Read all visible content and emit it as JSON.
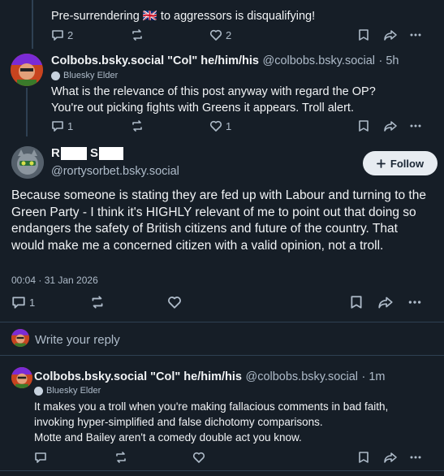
{
  "post_top": {
    "text": "Pre-surrendering 🇬🇧 to aggressors is disqualifying!",
    "reply_count": "2",
    "like_count": "2"
  },
  "post_col1": {
    "display_name": "Colbobs.bsky.social \"Col\" he/him/his",
    "handle": "@colbobs.bsky.social",
    "time": "· 5h",
    "badge": "Bluesky Elder",
    "text_line1": "What is the relevance of this post anyway with regard the OP?",
    "text_line2": "You're out picking fights with Greens it appears. Troll alert.",
    "reply_count": "1",
    "like_count": "1"
  },
  "main_post": {
    "name_initial1": "R",
    "name_initial2": "S",
    "handle": "@rortysorbet.bsky.social",
    "follow_label": "Follow",
    "text": "Because someone is stating they are fed up with Labour and turning to the Green Party - I think it's HIGHLY relevant of me to point out that doing so endangers the safety of British citizens and future of the country.  That would make me a concerned citizen with a valid opinion, not a troll.",
    "timestamp": "00:04 · 31 Jan 2026",
    "reply_count": "1"
  },
  "composer": {
    "placeholder": "Write your reply"
  },
  "post_col2": {
    "display_name": "Colbobs.bsky.social \"Col\" he/him/his",
    "handle": "@colbobs.bsky.social",
    "time": "· 1m",
    "badge": "Bluesky Elder",
    "text_line1": "It makes you a troll when you're making fallacious comments in bad faith,",
    "text_line2": "invoking hyper-simplified and false dichotomy comparisons.",
    "text_line3": "Motte and Bailey aren't a comedy double act you know."
  },
  "icons": [
    "reply-icon",
    "repost-icon",
    "like-icon",
    "bookmark-icon",
    "share-icon",
    "more-icon",
    "plus-icon",
    "elder-badge-icon"
  ],
  "colors": {
    "background": "#161e27",
    "muted": "#aebbc9",
    "divider": "#2e4052"
  }
}
